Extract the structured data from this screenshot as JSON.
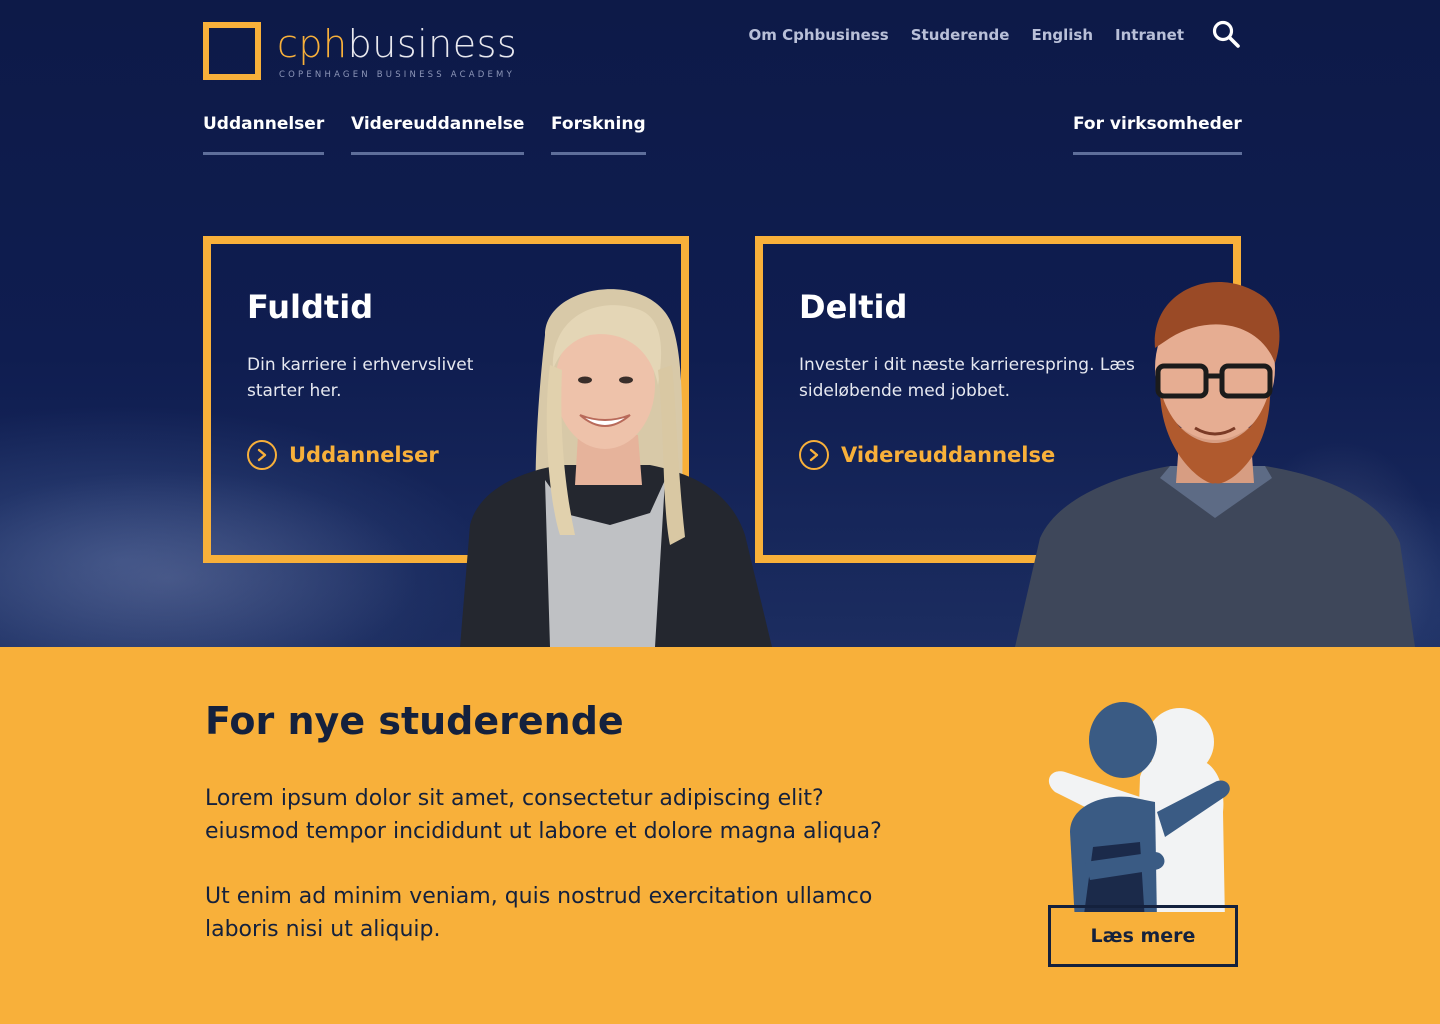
{
  "logo": {
    "prefix": "cph",
    "suffix": "business",
    "subtitle": "COPENHAGEN BUSINESS ACADEMY"
  },
  "topnav": [
    "Om Cphbusiness",
    "Studerende",
    "English",
    "Intranet"
  ],
  "mainnav": [
    "Uddannelser",
    "Videreuddannelse",
    "Forskning",
    "For virksomheder"
  ],
  "cards": [
    {
      "title": "Fuldtid",
      "desc": "Din karriere i erhvervslivet starter her.",
      "link": "Uddannelser"
    },
    {
      "title": "Deltid",
      "desc": "Invester i dit næste karrierespring. Læs sideløbende med jobbet.",
      "link": "Videreuddannelse"
    }
  ],
  "section": {
    "title": "For nye studerende",
    "p1": "Lorem ipsum dolor sit amet, consectetur adipiscing elit?\n eiusmod tempor incididunt ut labore et dolore magna aliqua?",
    "p2": "Ut enim ad minim veniam, quis nostrud exercitation ullamco\nlaboris nisi ut aliquip.",
    "button": "Læs mere"
  },
  "colors": {
    "accent": "#f8b03a",
    "navy": "#0f1d50",
    "text_dark": "#14213d"
  }
}
